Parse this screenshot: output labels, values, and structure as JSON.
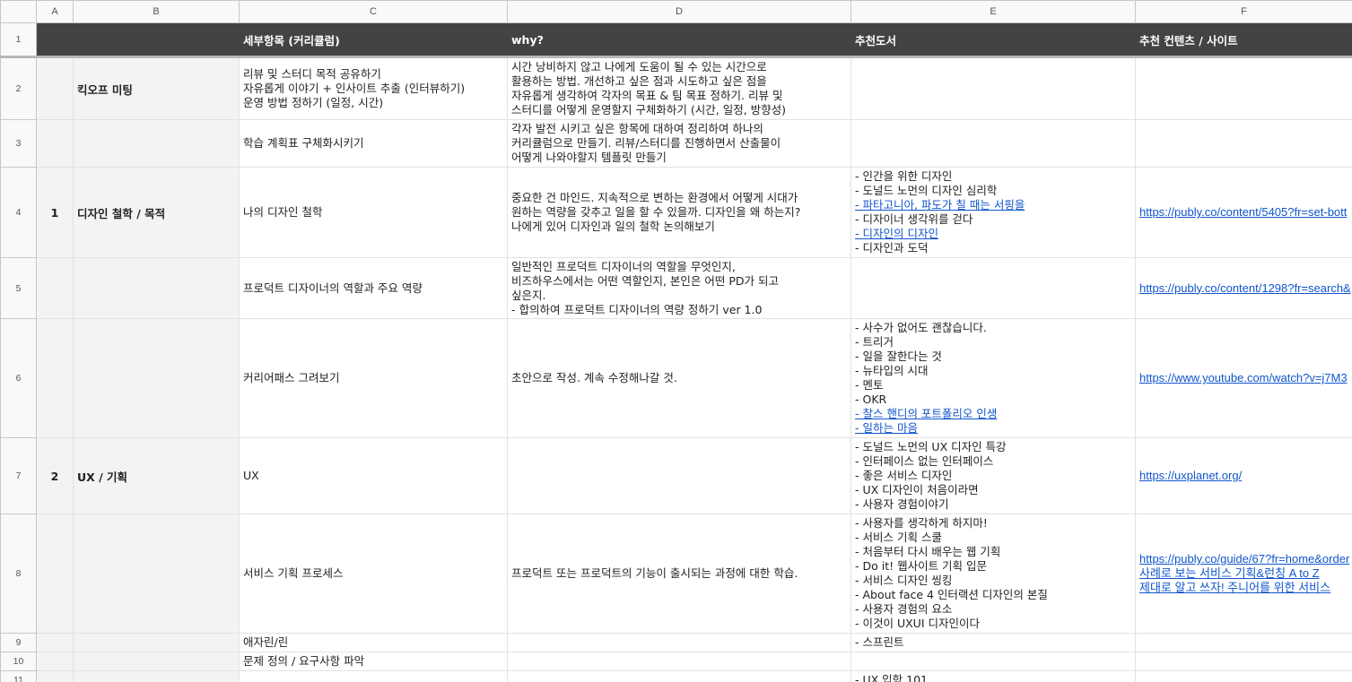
{
  "columns": [
    "A",
    "B",
    "C",
    "D",
    "E",
    "F"
  ],
  "header_row": {
    "num": "1",
    "c": "세부항목 (커리큘럼)",
    "d": "why?",
    "e": "추천도서",
    "f": "추천 컨텐츠 /  사이트"
  },
  "rows": [
    {
      "num": "2",
      "a": "",
      "b": "킥오프 미팅",
      "c": [
        "리뷰 및 스터디 목적 공유하기",
        "자유롭게 이야기 + 인사이트 추출 (인터뷰하기)",
        "운영 방법 정하기 (일정, 시간)"
      ],
      "d": [
        "시간 낭비하지 않고 나에게 도움이 될 수 있는 시간으로",
        "활용하는 방법. 개선하고 싶은 점과 시도하고 싶은 점을",
        "자유롭게 생각하여 각자의 목표 & 팀 목표 정하기. 리뷰 및",
        "스터디를 어떻게 운영할지 구체화하기 (시간, 일정, 방향성)"
      ],
      "e": [],
      "f": []
    },
    {
      "num": "3",
      "a": "",
      "b": "",
      "c": [
        "학습 계획표 구체화시키기"
      ],
      "d": [
        "각자 발전 시키고 싶은 항목에 대하여 정리하여 하나의",
        "커리큘럼으로 만들기. 리뷰/스터디를 진행하면서 산출물이",
        "어떻게 나와야할지 템플릿 만들기"
      ],
      "e": [],
      "f": []
    },
    {
      "num": "4",
      "a": "1",
      "b": "디자인 철학 / 목적",
      "c": [
        "나의 디자인 철학"
      ],
      "d": [
        "중요한 건 마인드. 지속적으로 변하는 환경에서 어떻게 시대가",
        "원하는 역량을 갖추고 일을 할 수 있을까. 디자인을 왜 하는지?",
        "나에게 있어 디자인과 일의 철학 논의해보기"
      ],
      "e": [
        {
          "t": "- 인간을 위한 디자인",
          "link": false
        },
        {
          "t": "- 도널드 노먼의 디자인 심리학",
          "link": false
        },
        {
          "t": "- 파타고니아, 파도가 칠 때는 서핑을",
          "link": true
        },
        {
          "t": "- 디자이너 생각위를 걷다",
          "link": false
        },
        {
          "t": "- 디자인의 디자인",
          "link": true
        },
        {
          "t": "- 디자인과 도덕",
          "link": false
        }
      ],
      "f": [
        "https://publy.co/content/5405?fr=set-bott"
      ]
    },
    {
      "num": "5",
      "a": "",
      "b": "",
      "c": [
        "프로덕트 디자이너의 역할과 주요 역량"
      ],
      "d": [
        "일반적인 프로덕트 디자이너의 역할을 무엇인지,",
        "비즈하우스에서는 어떤 역할인지, 본인은 어떤 PD가 되고",
        "싶은지.",
        "- 합의하여 프로덕트 디자이너의 역량 정하기 ver 1.0"
      ],
      "e": [],
      "f": [
        "https://publy.co/content/1298?fr=search&"
      ]
    },
    {
      "num": "6",
      "a": "",
      "b": "",
      "c": [
        "커리어패스 그려보기"
      ],
      "d": [
        "초안으로 작성. 계속 수정해나갈 것."
      ],
      "e": [
        {
          "t": "- 사수가 없어도 괜찮습니다.",
          "link": false
        },
        {
          "t": "- 트리거",
          "link": false
        },
        {
          "t": "- 일을 잘한다는 것",
          "link": false
        },
        {
          "t": "- 뉴타입의 시대",
          "link": false
        },
        {
          "t": "- 멘토",
          "link": false
        },
        {
          "t": "- OKR",
          "link": false
        },
        {
          "t": "- 찰스 핸디의 포트폴리오 인생",
          "link": true
        },
        {
          "t": "- 일하는 마음",
          "link": true
        }
      ],
      "f": [
        "https://www.youtube.com/watch?v=j7M3"
      ]
    },
    {
      "num": "7",
      "a": "2",
      "b": "UX / 기획",
      "c": [
        "UX"
      ],
      "d": [],
      "e": [
        {
          "t": "- 도널드 노먼의 UX 디자인 특강",
          "link": false
        },
        {
          "t": "- 인터페이스 없는 인터페이스",
          "link": false
        },
        {
          "t": "- 좋은 서비스 디자인",
          "link": false
        },
        {
          "t": "- UX 디자인이 처음이라면",
          "link": false
        },
        {
          "t": "- 사용자 경험이야기",
          "link": false
        }
      ],
      "f": [
        "https://uxplanet.org/"
      ]
    },
    {
      "num": "8",
      "a": "",
      "b": "",
      "c": [
        "서비스 기획 프로세스"
      ],
      "d": [
        "프로덕트 또는 프로덕트의 기능이 출시되는 과정에 대한 학습."
      ],
      "e": [
        {
          "t": "- 사용자를 생각하게 하지마!",
          "link": false
        },
        {
          "t": "- 서비스 기획 스쿨",
          "link": false
        },
        {
          "t": "- 처음부터 다시 배우는 웹 기획",
          "link": false
        },
        {
          "t": "- Do it! 웹사이트 기획 입문",
          "link": false
        },
        {
          "t": "- 서비스 디자인 씽킹",
          "link": false
        },
        {
          "t": "- About face 4 인터랙션 디자인의 본질",
          "link": false
        },
        {
          "t": "- 사용자 경험의 요소",
          "link": false
        },
        {
          "t": "- 이것이 UXUI 디자인이다",
          "link": false
        }
      ],
      "f": [
        "https://publy.co/guide/67?fr=home&order",
        "사례로 보는 서비스 기획&런칭 A to Z",
        "제대로 알고 쓰자! 주니어를 위한 서비스"
      ]
    },
    {
      "num": "9",
      "a": "",
      "b": "",
      "c": [
        "애자린/린"
      ],
      "d": [],
      "e": [
        {
          "t": "- 스프린트",
          "link": false
        }
      ],
      "f": []
    },
    {
      "num": "10",
      "a": "",
      "b": "",
      "c": [
        "문제 정의 / 요구사항 파악"
      ],
      "d": [],
      "e": [],
      "f": []
    },
    {
      "num": "11",
      "a": "",
      "b": "",
      "c": [],
      "d": [],
      "e": [
        {
          "t": "- UX 입학 101",
          "link": false
        }
      ],
      "f": []
    }
  ],
  "colors": {
    "header_dark": "#434343",
    "gray_fill": "#f3f3f3",
    "link": "#1155cc"
  }
}
